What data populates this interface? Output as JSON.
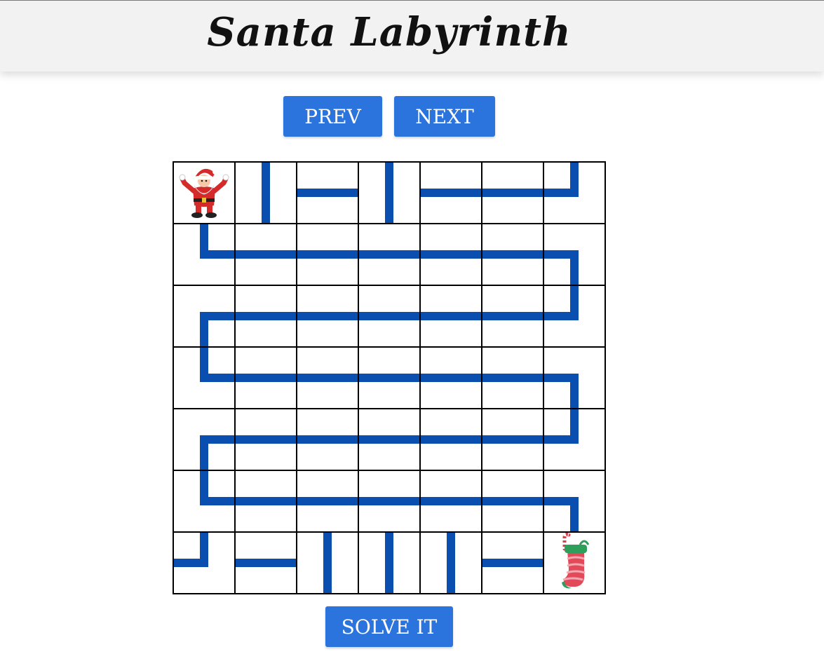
{
  "header": {
    "title": "Santa Labyrinth"
  },
  "controls": {
    "prev_label": "PREV",
    "next_label": "NEXT",
    "solve_label": "SOLVE IT"
  },
  "maze": {
    "rows": 7,
    "cols": 7,
    "path_color": "#0a4fb0",
    "grid_color": "#000000",
    "start": {
      "row": 0,
      "col": 0,
      "icon": "santa-icon"
    },
    "goal": {
      "row": 6,
      "col": 6,
      "icon": "stocking-icon"
    },
    "tiles": [
      [
        "start",
        "vertical",
        "horizontal",
        "vertical",
        "horizontal",
        "horizontal",
        "corner-left-up"
      ],
      [
        "corner-up-right",
        "horizontal",
        "horizontal",
        "horizontal",
        "horizontal",
        "horizontal",
        "corner-left-down"
      ],
      [
        "corner-right-down",
        "horizontal",
        "horizontal",
        "horizontal",
        "horizontal",
        "horizontal",
        "corner-left-up"
      ],
      [
        "corner-up-right",
        "horizontal",
        "horizontal",
        "horizontal",
        "horizontal",
        "horizontal",
        "corner-left-down"
      ],
      [
        "corner-right-down",
        "horizontal",
        "horizontal",
        "horizontal",
        "horizontal",
        "horizontal",
        "corner-left-up"
      ],
      [
        "corner-up-right",
        "horizontal",
        "horizontal",
        "horizontal",
        "horizontal",
        "horizontal",
        "corner-left-down"
      ],
      [
        "corner-left-up",
        "horizontal",
        "vertical",
        "vertical",
        "vertical",
        "horizontal",
        "goal"
      ]
    ]
  }
}
